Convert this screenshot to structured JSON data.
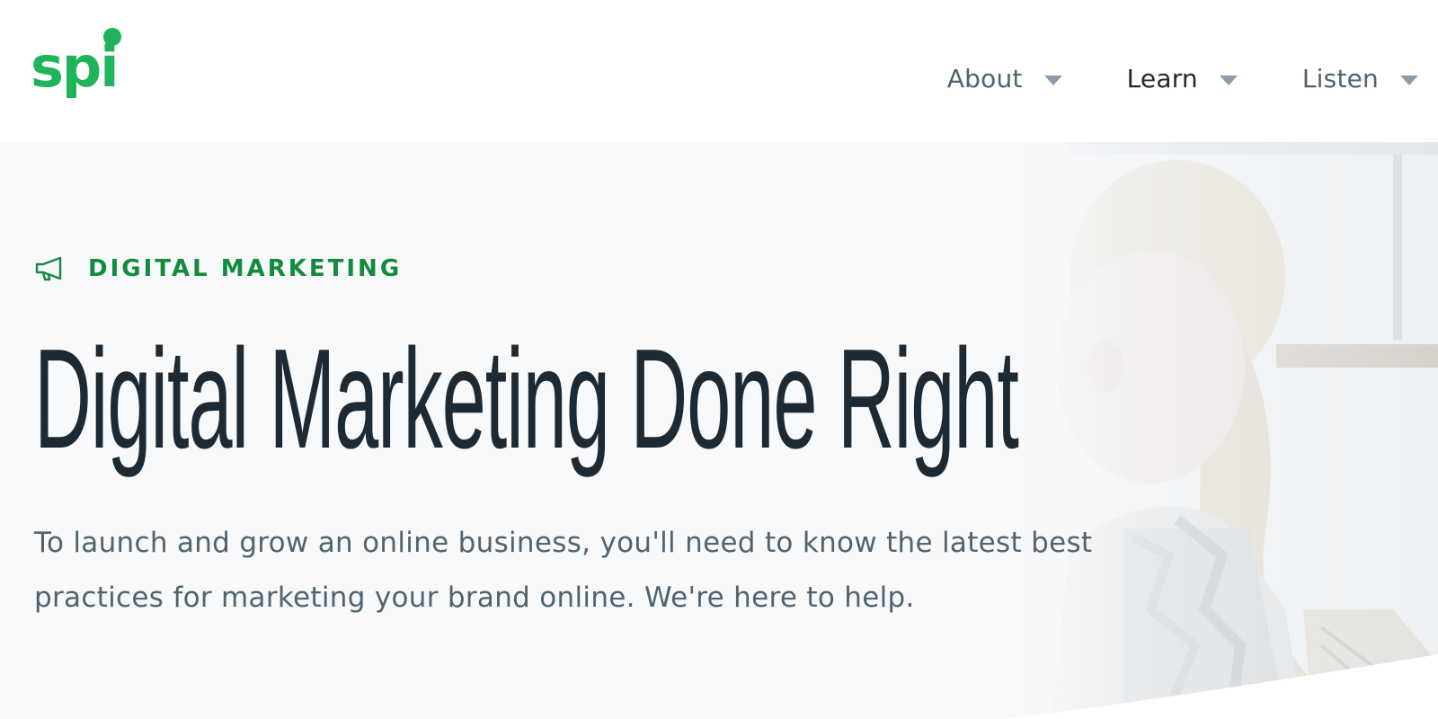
{
  "brand": {
    "logo_text": "spi",
    "accent_color": "#1fb35a",
    "accent_dark": "#138a3d"
  },
  "nav": {
    "items": [
      {
        "label": "About",
        "icon": "chevron-down-icon"
      },
      {
        "label": "Learn",
        "icon": "chevron-down-icon"
      },
      {
        "label": "Listen",
        "icon": "chevron-down-icon"
      }
    ]
  },
  "hero": {
    "category_icon": "megaphone-icon",
    "category_label": "DIGITAL MARKETING",
    "title": "Digital Marketing Done Right",
    "description": "To launch and grow an online business, you'll need to know the latest best practices for marketing your brand online. We're here to help.",
    "background_color": "#f8f9fb",
    "text_color": "#1e2a33",
    "muted_text_color": "#4f6470"
  }
}
